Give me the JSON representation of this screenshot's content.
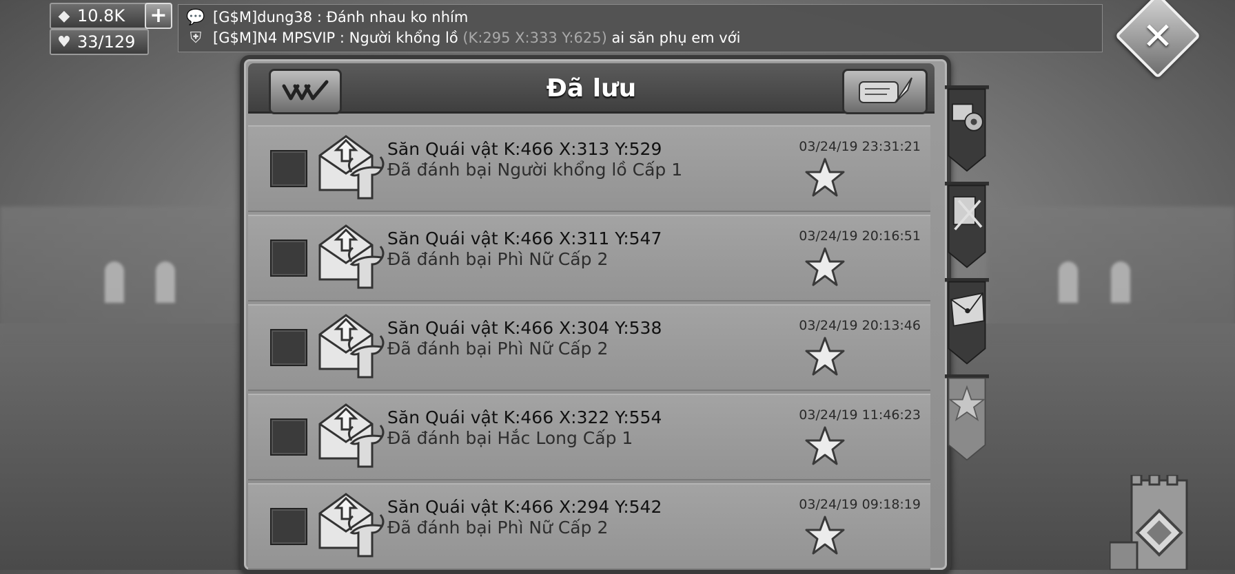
{
  "resources": {
    "gems": "10.8K",
    "stamina": "33/129",
    "gems_icon": "gem-icon",
    "stamina_icon": "heart-icon"
  },
  "chat": {
    "line1": {
      "sender": "[G$M]dung38",
      "separator": " : ",
      "message": "Đánh nhau ko nhím"
    },
    "line2": {
      "sender": "[G$M]N4 MPSVIP",
      "separator": " : ",
      "message_before": "Người khổng lồ ",
      "coord": "(K:295 X:333 Y:625)",
      "message_after": " ai săn phụ em với"
    }
  },
  "panel": {
    "title": "Đã lưu"
  },
  "mails": [
    {
      "title": "Săn Quái vật K:466 X:313 Y:529",
      "subtitle": "Đã đánh bại Người khổng lồ Cấp 1",
      "time": "03/24/19 23:31:21"
    },
    {
      "title": "Săn Quái vật K:466 X:311 Y:547",
      "subtitle": "Đã đánh bại Phì Nữ Cấp 2",
      "time": "03/24/19 20:16:51"
    },
    {
      "title": "Săn Quái vật K:466 X:304 Y:538",
      "subtitle": "Đã đánh bại Phì Nữ Cấp 2",
      "time": "03/24/19 20:13:46"
    },
    {
      "title": "Săn Quái vật K:466 X:322 Y:554",
      "subtitle": "Đã đánh bại Hắc Long Cấp 1",
      "time": "03/24/19 11:46:23"
    },
    {
      "title": "Săn Quái vật K:466 X:294 Y:542",
      "subtitle": "Đã đánh bại Phì Nữ Cấp 2",
      "time": "03/24/19 09:18:19"
    }
  ],
  "side_tabs": [
    "tab-system",
    "tab-reports",
    "tab-messages",
    "tab-saved"
  ]
}
